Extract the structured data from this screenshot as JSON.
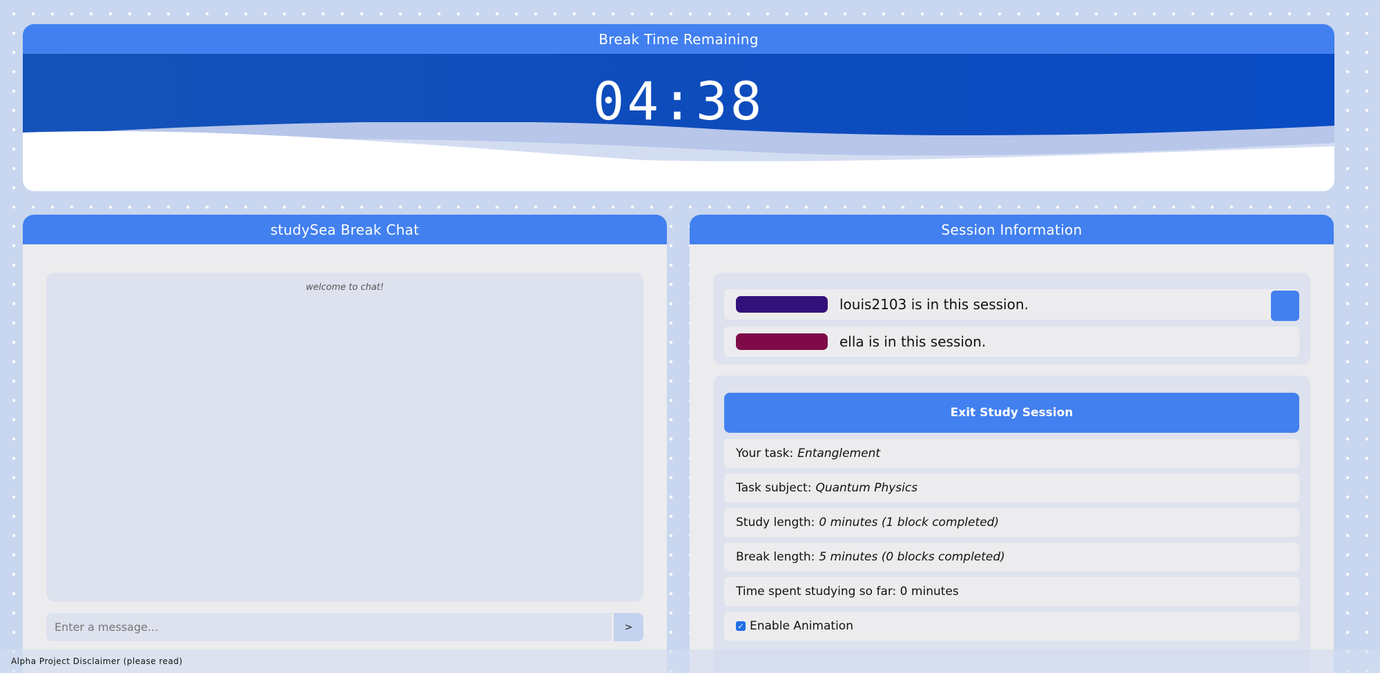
{
  "timer": {
    "header": "Break Time Remaining",
    "time": "04:38"
  },
  "chat": {
    "header": "studySea Break Chat",
    "welcome": "welcome to chat!",
    "input_placeholder": "Enter a message...",
    "send_label": ">"
  },
  "session": {
    "header": "Session Information",
    "members": [
      {
        "text": "louis2103 is in this session.",
        "color": "#33117a"
      },
      {
        "text": "ella is in this session.",
        "color": "#7e0b47"
      }
    ],
    "exit_label": "Exit Study Session",
    "task_label": "Your task:",
    "task_value": "Entanglement",
    "subject_label": "Task subject:",
    "subject_value": "Quantum Physics",
    "study_length_label": "Study length:",
    "study_length_value": "0 minutes (1 block completed)",
    "break_length_label": "Break length:",
    "break_length_value": "5 minutes (0 blocks completed)",
    "time_spent": "Time spent studying so far: 0 minutes",
    "animation_label": "Enable Animation",
    "animation_enabled": true
  },
  "footer": {
    "disclaimer": "Alpha Project Disclaimer (please read)"
  },
  "colors": {
    "accent": "#4280ef",
    "timer_bg": "#0e4cbc"
  }
}
